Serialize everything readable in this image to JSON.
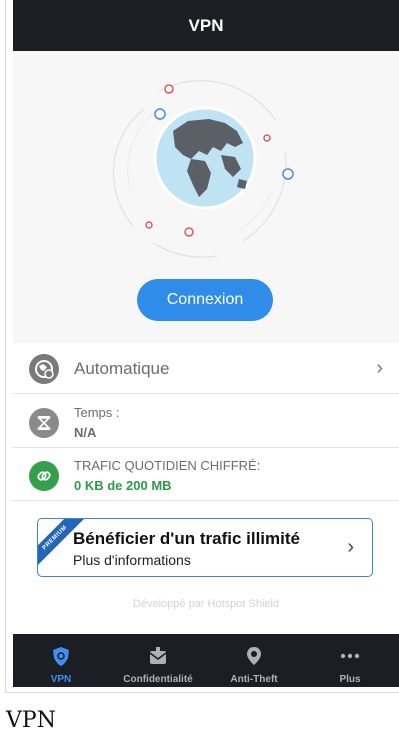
{
  "header": {
    "title": "VPN"
  },
  "hero": {
    "connect_label": "Connexion",
    "globe_color": "#bfe3f3",
    "land_color": "#5b5f66",
    "orbit_dot_red": "#e05a5a",
    "orbit_dot_blue": "#3f8ef0"
  },
  "location": {
    "label": "Automatique",
    "icon": "globe-pin-icon"
  },
  "time": {
    "label": "Temps :",
    "value": "N/A",
    "icon": "hourglass-icon"
  },
  "traffic": {
    "label": "TRAFIC QUOTIDIEN CHIFFRÉ:",
    "value": "0 KB de 200 MB",
    "icon": "link-icon",
    "accent": "#2e9a47"
  },
  "premium": {
    "ribbon": "PREMIUM",
    "title": "Bénéficier d'un trafic illimité",
    "subtitle": "Plus d'informations",
    "border_color": "#3f83d6"
  },
  "footer": {
    "credit": "Développé par Hotspot Shield"
  },
  "tabs": [
    {
      "label": "VPN",
      "icon": "shield-icon",
      "active": true
    },
    {
      "label": "Confidentialité",
      "icon": "privacy-envelope-icon",
      "active": false
    },
    {
      "label": "Anti-Theft",
      "icon": "location-pin-icon",
      "active": false
    },
    {
      "label": "Plus",
      "icon": "more-dots-icon",
      "active": false
    }
  ],
  "caption": "VPN",
  "colors": {
    "accent": "#2f8ce8",
    "dark_bar": "#1b1e25"
  }
}
